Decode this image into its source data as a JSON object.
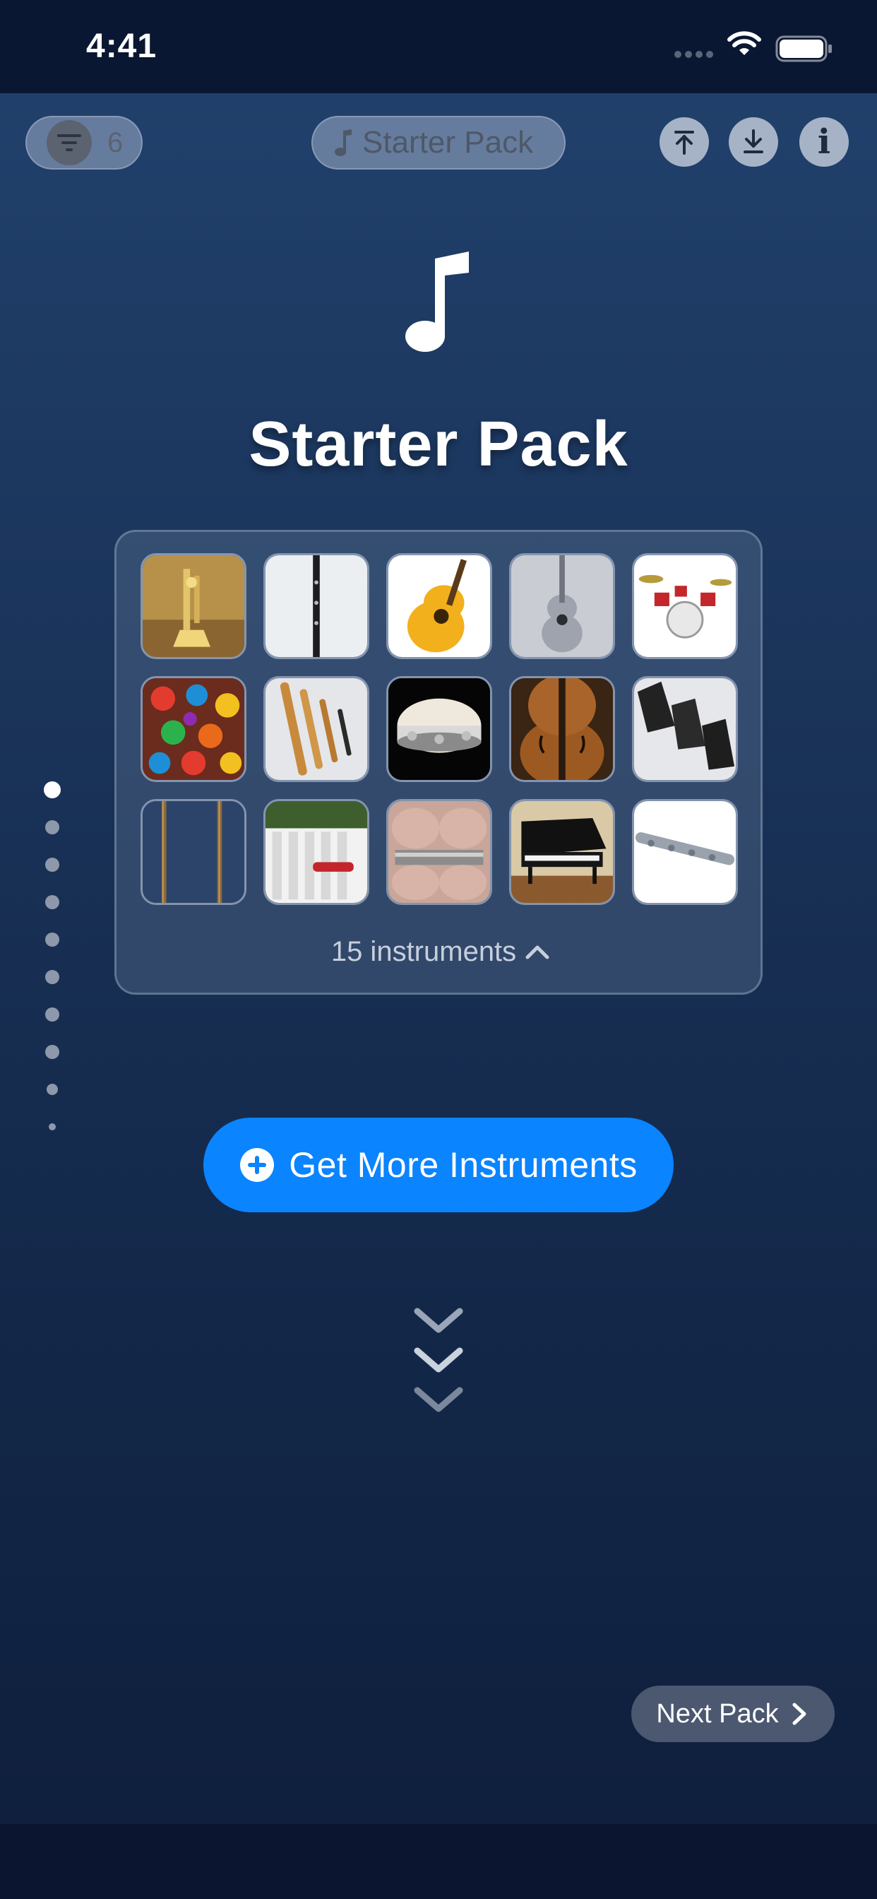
{
  "status_bar": {
    "time": "4:41"
  },
  "toolbar": {
    "filter_count": "6",
    "pack_selector_label": "Starter Pack"
  },
  "pack": {
    "title": "Starter Pack",
    "instrument_count_label": "15 instruments",
    "instruments": [
      {
        "name": "trumpet"
      },
      {
        "name": "clarinet"
      },
      {
        "name": "acoustic guitar"
      },
      {
        "name": "ukulele"
      },
      {
        "name": "drum kit"
      },
      {
        "name": "maracas"
      },
      {
        "name": "recorders"
      },
      {
        "name": "tambourine"
      },
      {
        "name": "cello"
      },
      {
        "name": "cowbells"
      },
      {
        "name": "rainstick"
      },
      {
        "name": "xylophone"
      },
      {
        "name": "harmonica"
      },
      {
        "name": "grand piano"
      },
      {
        "name": "flute"
      }
    ]
  },
  "pagination": {
    "count": 10,
    "active_index": 0
  },
  "actions": {
    "get_more_label": "Get More Instruments",
    "next_pack_label": "Next Pack"
  },
  "colors": {
    "accent": "#0a84ff",
    "background_top": "#20406b",
    "background_bottom": "#0f1f3d"
  },
  "icons": {
    "filter": "filter-lines-icon",
    "note": "music-note-icon",
    "upload": "upload-to-top-icon",
    "download": "download-icon",
    "info": "info-icon",
    "plus": "plus-circle-icon",
    "chevron_up": "chevron-up-icon",
    "chevron_right": "chevron-right-icon",
    "scroll_hint": "triple-chevron-down-icon"
  }
}
